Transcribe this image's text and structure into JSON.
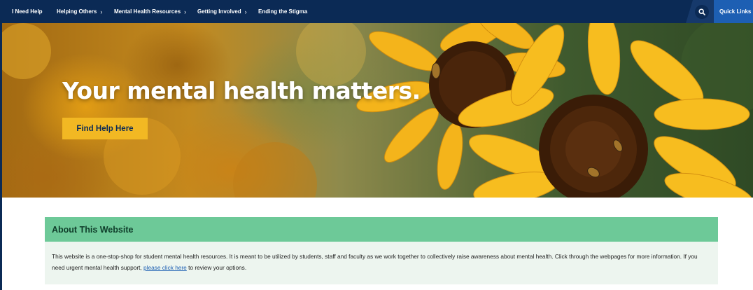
{
  "nav": {
    "items": [
      {
        "label": "I Need Help"
      },
      {
        "label": "Helping Others",
        "chevron": "›"
      },
      {
        "label": "Mental Health Resources",
        "chevron": "›"
      },
      {
        "label": "Getting Involved",
        "chevron": "›"
      },
      {
        "label": "Ending the Stigma"
      }
    ],
    "search_icon": "search-icon",
    "quick_links": {
      "label": "Quick Links",
      "chevron": "‹"
    }
  },
  "hero": {
    "title": "Your mental health matters.",
    "button_label": "Find Help Here"
  },
  "about": {
    "title": "About This Website",
    "body_before_link": "This website is a one-stop-shop for student mental health resources. It is meant to be utilized by students, staff and faculty as we work together to collectively raise awareness about mental health. Click through the webpages for more information. If you need urgent mental health support, ",
    "link_text": "please click here",
    "body_after_link": " to review your options."
  },
  "colors": {
    "nav_bg": "#0b2a55",
    "quick_links_bg": "#1d5fb3",
    "button_yellow": "#f2b823",
    "about_header_green": "#6dc998",
    "about_body_bg": "#edf5ef"
  }
}
